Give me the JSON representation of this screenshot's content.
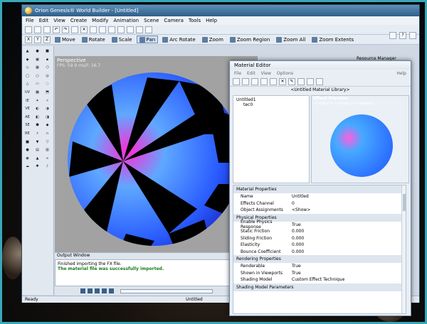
{
  "app": {
    "title": "Orion Genesis® World Builder - [Untitled]",
    "menus": [
      "File",
      "Edit",
      "View",
      "Create",
      "Modify",
      "Animation",
      "Scene",
      "Camera",
      "Tools",
      "Help"
    ],
    "toolbar_buttons": [
      "Move",
      "Rotate",
      "Scale",
      "Pan",
      "Arc Rotate",
      "Zoom",
      "Zoom Region",
      "Zoom All",
      "Zoom Extents"
    ],
    "active_button": "Pan",
    "axis_buttons": [
      "X",
      "Y",
      "Z"
    ],
    "left_tool_labels": [
      "UV",
      "IE",
      "VE",
      "AE",
      "SE",
      "RE"
    ],
    "resource_manager_label": "Resource Manager"
  },
  "viewport": {
    "label": "Perspective",
    "fps": "FPS: 59.9   ms/F: 16.7"
  },
  "output": {
    "title": "Output Window",
    "lines": [
      "Finished importing the FX file.",
      "The material file was successfully imported."
    ]
  },
  "status": {
    "left": "Ready",
    "center": "Untitled"
  },
  "material_editor": {
    "title": "Material Editor",
    "menus": [
      "File",
      "Edit",
      "View",
      "Options"
    ],
    "help": "Help",
    "library": "<Untitled Material Library>",
    "tree": [
      "Untitled1",
      "tec0"
    ],
    "preview_title": "Effect Preview",
    "preview_subtitle": "an effect is currently not selected...",
    "sections": [
      {
        "title": "Material Properties",
        "rows": [
          [
            "Name",
            "Untitled"
          ],
          [
            "Effects Channel",
            "0"
          ],
          [
            "Object Assignments",
            "<Show>"
          ]
        ]
      },
      {
        "title": "Physical Properties",
        "rows": [
          [
            "Enable Physics Response",
            "True"
          ],
          [
            "Static Friction",
            "0.000"
          ],
          [
            "Sliding Friction",
            "0.000"
          ],
          [
            "Elasticity",
            "0.000"
          ],
          [
            "Bounce Coefficient",
            "0.000"
          ]
        ]
      },
      {
        "title": "Rendering Properties",
        "rows": [
          [
            "Renderable",
            "True"
          ],
          [
            "Shown in Viewports",
            "True"
          ],
          [
            "Shading Model",
            "Custom Effect Technique"
          ]
        ]
      },
      {
        "title": "Shading Model Parameters",
        "rows": []
      }
    ]
  },
  "colors": {
    "frame_border": "#3aa7b8",
    "titlebar": "#2f5f8a",
    "success_text": "#1a7a1a",
    "sphere_blue": "#2a7fff",
    "sphere_magenta": "#ff2bd6"
  }
}
